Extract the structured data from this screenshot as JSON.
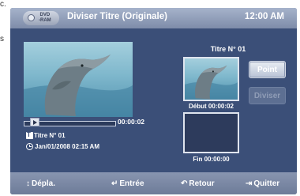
{
  "header": {
    "disc_top": "DVD",
    "disc_bottom": "-RAM",
    "title": "Diviser Titre (Originale)",
    "clock": "12:00 AM"
  },
  "player": {
    "current_time": "00:00:02",
    "title_label": "Titre N° 01",
    "datetime": "Jan/01/2008  02:15 AM"
  },
  "split": {
    "title_no": "Titre N° 01",
    "debut_label": "Début 00:00:02",
    "fin_label": "Fin 00:00:00"
  },
  "buttons": {
    "point_label": "Point",
    "diviser_label": "Diviser"
  },
  "footer": {
    "move_icon": "updown-arrows-icon",
    "move_label": "Dépla.",
    "enter_icon": "enter-icon",
    "enter_label": "Entrée",
    "back_icon": "return-icon",
    "back_label": "Retour",
    "quit_icon": "exit-icon",
    "quit_label": "Quitter"
  },
  "colors": {
    "panel_background": "#3b4f78",
    "header_bar": "#8e9bb6",
    "footer_bar": "#7a88a5"
  }
}
